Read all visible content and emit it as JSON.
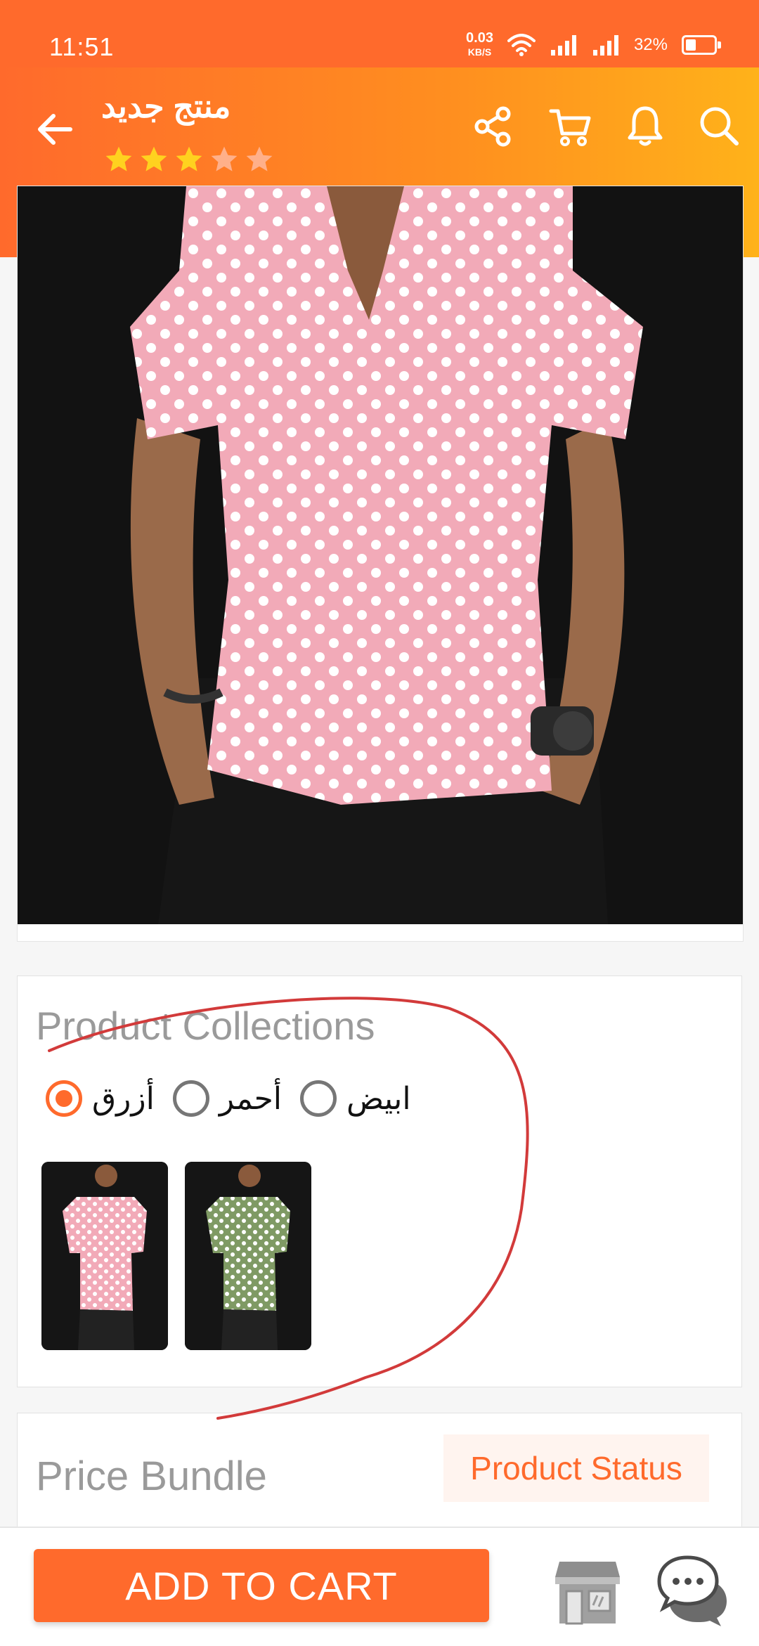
{
  "status_bar": {
    "time": "11:51",
    "net_speed": "0.03",
    "net_unit": "KB/S",
    "battery": "32%"
  },
  "header": {
    "title": "منتج جديد",
    "rating": 3,
    "rating_max": 5
  },
  "collections": {
    "title": "Product Collections",
    "options": [
      {
        "label": "أزرق",
        "selected": true
      },
      {
        "label": "أحمر",
        "selected": false
      },
      {
        "label": "ابيض",
        "selected": false
      }
    ],
    "thumbnails": [
      {
        "shirt_color": "#f2aab8",
        "name": "pink-shirt-thumbnail"
      },
      {
        "shirt_color": "#7f9a64",
        "name": "green-shirt-thumbnail"
      }
    ]
  },
  "price": {
    "title": "Price Bundle",
    "status_label": "Product Status"
  },
  "bottom": {
    "add_to_cart": "ADD TO CART"
  },
  "colors": {
    "accent": "#ff6a2c",
    "header_gradient_end": "#ffb21a",
    "star_on": "#ffd21f",
    "star_off": "#ffb08a"
  }
}
